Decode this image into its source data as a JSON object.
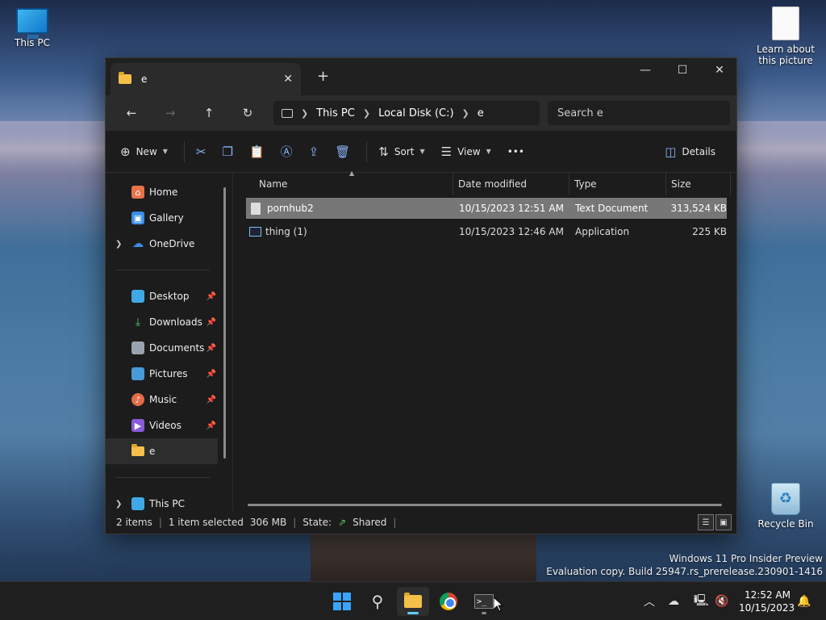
{
  "desktop": {
    "icons": [
      {
        "label": "This PC"
      },
      {
        "label": "Learn about this picture"
      },
      {
        "label": "Recycle Bin"
      }
    ],
    "watermark": {
      "line1": "Windows 11 Pro Insider Preview",
      "line2": "Evaluation copy. Build 25947.rs_prerelease.230901-1416"
    }
  },
  "window": {
    "tab_title": "e",
    "tab_close": "✕",
    "new_tab": "+",
    "controls": {
      "minimize": "—",
      "maximize": "☐",
      "close": "✕"
    },
    "nav": {
      "back": "←",
      "forward": "→",
      "up": "↑",
      "refresh": "↻"
    },
    "breadcrumb": [
      "This PC",
      "Local Disk (C:)",
      "e"
    ],
    "search_placeholder": "Search e",
    "commands": {
      "new_label": "New",
      "sort_label": "Sort",
      "view_label": "View",
      "more_label": "•••",
      "details_label": "Details"
    },
    "sidebar": {
      "top": [
        {
          "label": "Home"
        },
        {
          "label": "Gallery"
        },
        {
          "label": "OneDrive"
        }
      ],
      "quick": [
        {
          "label": "Desktop"
        },
        {
          "label": "Downloads"
        },
        {
          "label": "Documents"
        },
        {
          "label": "Pictures"
        },
        {
          "label": "Music"
        },
        {
          "label": "Videos"
        },
        {
          "label": "e"
        }
      ],
      "bottom": [
        {
          "label": "This PC"
        }
      ]
    },
    "columns": [
      "Name",
      "Date modified",
      "Type",
      "Size"
    ],
    "files": [
      {
        "name": "pornhub2",
        "date": "10/15/2023 12:51 AM",
        "type": "Text Document",
        "size": "313,524 KB"
      },
      {
        "name": "thing (1)",
        "date": "10/15/2023 12:46 AM",
        "type": "Application",
        "size": "225 KB"
      }
    ],
    "status": {
      "count": "2 items",
      "selected": "1 item selected",
      "size": "306 MB",
      "state_label": "State:",
      "state_value": "Shared"
    }
  },
  "taskbar": {
    "time": "12:52 AM",
    "date": "10/15/2023"
  },
  "colors": {
    "accent": "#60cdff",
    "selection": "#777777",
    "window_bg": "#1c1c1c"
  }
}
